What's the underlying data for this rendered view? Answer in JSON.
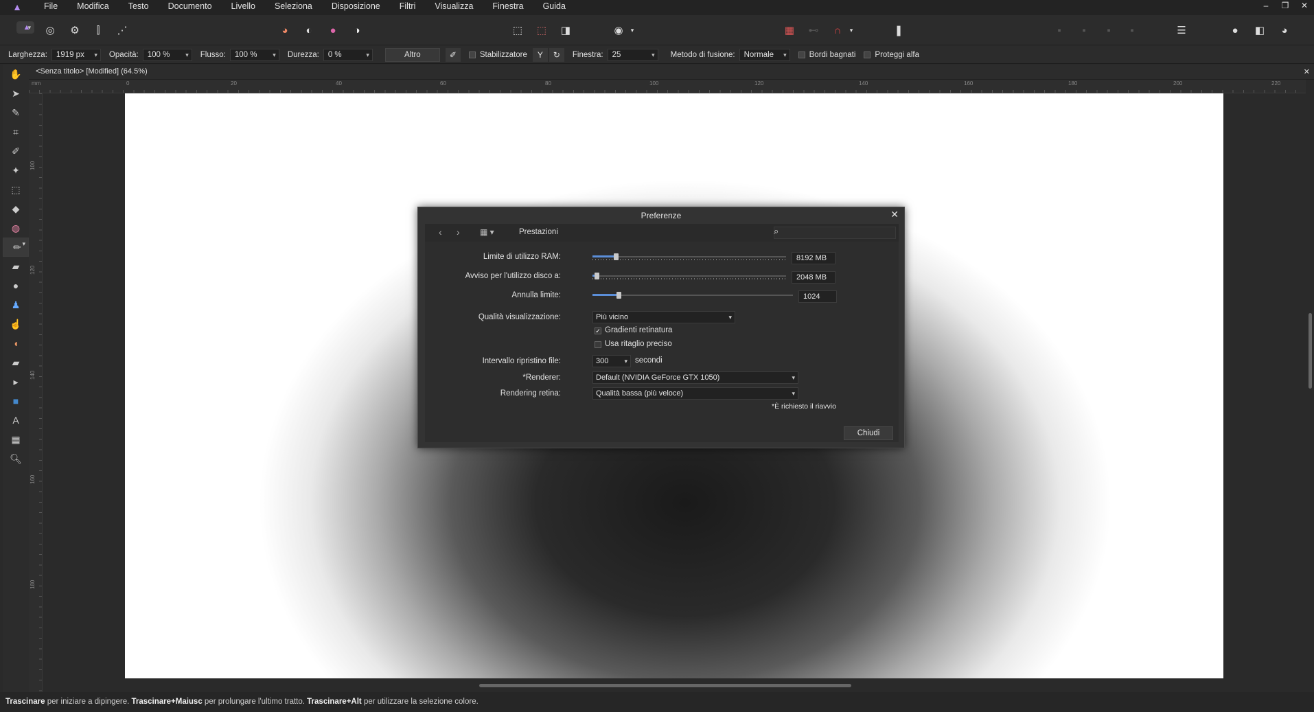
{
  "menubar": {
    "items": [
      "File",
      "Modifica",
      "Testo",
      "Documento",
      "Livello",
      "Seleziona",
      "Disposizione",
      "Filtri",
      "Visualizza",
      "Finestra",
      "Guida"
    ]
  },
  "context_toolbar": {
    "width_label": "Larghezza:",
    "width_value": "1919 px",
    "opacity_label": "Opacità:",
    "opacity_value": "100 %",
    "flow_label": "Flusso:",
    "flow_value": "100 %",
    "hardness_label": "Durezza:",
    "hardness_value": "0 %",
    "more_label": "Altro",
    "stabilizer_label": "Stabilizzatore",
    "window_label": "Finestra:",
    "window_value": "25",
    "blend_label": "Metodo di fusione:",
    "blend_value": "Normale",
    "wet_edges_label": "Bordi bagnati",
    "protect_alpha_label": "Proteggi alfa"
  },
  "document": {
    "tab_title": "<Senza titolo> [Modified] (64.5%)",
    "ruler_unit": "mm",
    "h_ticks": [
      "0",
      "20",
      "40",
      "60",
      "80",
      "100",
      "120",
      "140",
      "160",
      "180",
      "200",
      "220"
    ],
    "v_ticks": [
      "100",
      "120",
      "140",
      "160",
      "180"
    ]
  },
  "dialog": {
    "title": "Preferenze",
    "section": "Prestazioni",
    "ram_label": "Limite di utilizzo RAM:",
    "ram_value": "8192 MB",
    "ram_fraction": 0.12,
    "disk_label": "Avviso per l'utilizzo disco a:",
    "disk_value": "2048 MB",
    "disk_fraction": 0.02,
    "undo_label": "Annulla limite:",
    "undo_value": "1024",
    "undo_fraction": 0.13,
    "display_quality_label": "Qualità visualizzazione:",
    "display_quality_value": "Più vicino",
    "retina_gradients_label": "Gradienti retinatura",
    "retina_gradients_checked": true,
    "precise_clip_label": "Usa ritaglio preciso",
    "precise_clip_checked": false,
    "autosave_label": "Intervallo ripristino file:",
    "autosave_value": "300",
    "autosave_unit": "secondi",
    "renderer_label": "*Renderer:",
    "renderer_value": "Default (NVIDIA GeForce GTX 1050)",
    "retina_render_label": "Rendering retina:",
    "retina_render_value": "Qualità bassa (più veloce)",
    "restart_note": "*È richiesto il riavvio",
    "close_label": "Chiudi"
  },
  "status": {
    "b1": "Trascinare",
    "t1": " per iniziare a dipingere. ",
    "b2": "Trascinare+Maiusc",
    "t2": " per prolungare l'ultimo tratto. ",
    "b3": "Trascinare+Alt",
    "t3": " per utilizzare la selezione colore."
  }
}
